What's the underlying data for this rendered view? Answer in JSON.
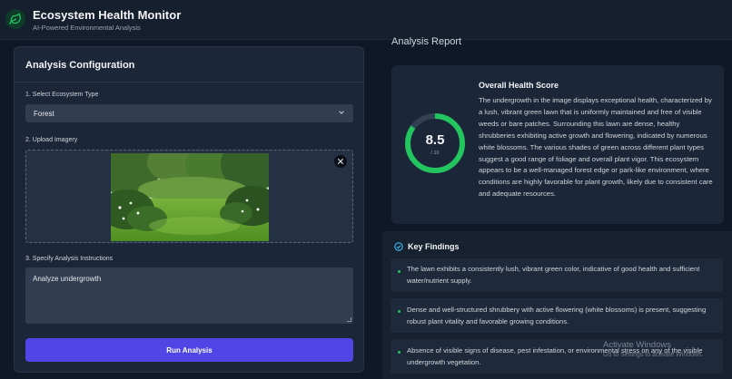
{
  "header": {
    "title": "Ecosystem Health Monitor",
    "subtitle": "AI-Powered Environmental Analysis",
    "logo_icon": "leaf-icon"
  },
  "config": {
    "title": "Analysis Configuration",
    "ecosystem_label": "1. Select Ecosystem Type",
    "ecosystem_value": "Forest",
    "upload_label": "2. Upload Imagery",
    "instructions_label": "3. Specify Analysis Instructions",
    "instructions_value": "Analyze undergrowth",
    "run_button": "Run Analysis"
  },
  "report": {
    "heading": "Analysis Report",
    "score": {
      "title": "Overall Health Score",
      "value": "8.5",
      "max": "/ 10",
      "fraction": 0.85,
      "description": "The undergrowth in the image displays exceptional health, characterized by a lush, vibrant green lawn that is uniformly maintained and free of visible weeds or bare patches. Surrounding this lawn are dense, healthy shrubberies exhibiting active growth and flowering, indicated by numerous white blossoms. The various shades of green across different plant types suggest a good range of foliage and overall plant vigor. This ecosystem appears to be a well-managed forest edge or park-like environment, where conditions are highly favorable for plant growth, likely due to consistent care and adequate resources."
    },
    "findings": {
      "title": "Key Findings",
      "items": [
        "The lawn exhibits a consistently lush, vibrant green color, indicative of good health and sufficient water/nutrient supply.",
        "Dense and well-structured shrubbery with active flowering (white blossoms) is present, suggesting robust plant vitality and favorable growing conditions.",
        "Absence of visible signs of disease, pest infestation, or environmental stress on any of the visible undergrowth vegetation."
      ]
    }
  },
  "watermark": {
    "title": "Activate Windows",
    "subtitle": "Go to Settings to activate Windows."
  },
  "colors": {
    "accent": "#4f46e5",
    "score_ring": "#22c55e",
    "background": "#101827",
    "panel": "#1b2638"
  }
}
